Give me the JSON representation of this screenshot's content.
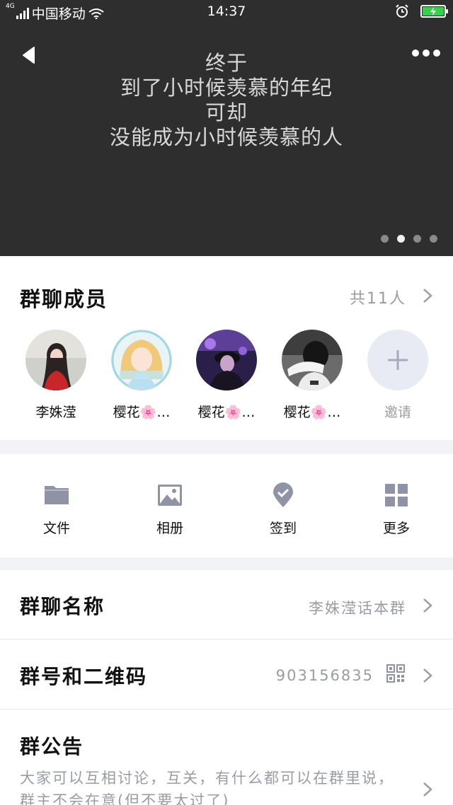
{
  "status_bar": {
    "network": "4G",
    "carrier": "中国移动",
    "time": "14:37"
  },
  "banner": {
    "lines": [
      "终于",
      "到了小时候羡慕的年纪",
      "可却",
      "没能成为小时候羡慕的人"
    ],
    "page_count": 4,
    "active_page": 2
  },
  "members": {
    "title": "群聊成员",
    "count": "共11人",
    "list": [
      {
        "name": "李姝滢"
      },
      {
        "name": "樱花🌸…"
      },
      {
        "name": "樱花🌸…"
      },
      {
        "name": "樱花🌸…"
      }
    ],
    "invite_label": "邀请"
  },
  "tools": [
    {
      "label": "文件",
      "icon": "folder-icon"
    },
    {
      "label": "相册",
      "icon": "image-icon"
    },
    {
      "label": "签到",
      "icon": "checkin-icon"
    },
    {
      "label": "更多",
      "icon": "grid-icon"
    }
  ],
  "group_name": {
    "label": "群聊名称",
    "value": "李姝滢话本群"
  },
  "group_id": {
    "label": "群号和二维码",
    "value": "903156835"
  },
  "notice": {
    "label": "群公告",
    "text": "大家可以互相讨论，互关，有什么都可以在群里说，群主不会在意(但不要太过了)"
  },
  "colors": {
    "banner_bg": "#2e2e2e",
    "secondary_text": "#9a9ca5",
    "icon_grey": "#8e93a6",
    "battery_green": "#36d14a"
  }
}
